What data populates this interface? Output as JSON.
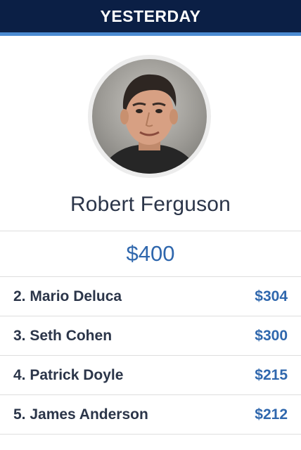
{
  "header": {
    "title": "YESTERDAY"
  },
  "winner": {
    "avatar_icon": "person-photo",
    "name": "Robert Ferguson",
    "amount": "$400"
  },
  "leaders": [
    {
      "label": "2. Mario Deluca",
      "amount": "$304"
    },
    {
      "label": "3. Seth Cohen",
      "amount": "$300"
    },
    {
      "label": "4. Patrick Doyle",
      "amount": "$215"
    },
    {
      "label": "5. James Anderson",
      "amount": "$212"
    }
  ],
  "colors": {
    "header_bg": "#0b1f45",
    "header_rule": "#4b8ad1",
    "amount_blue": "#2f67ad",
    "name_text": "#2b3549"
  }
}
